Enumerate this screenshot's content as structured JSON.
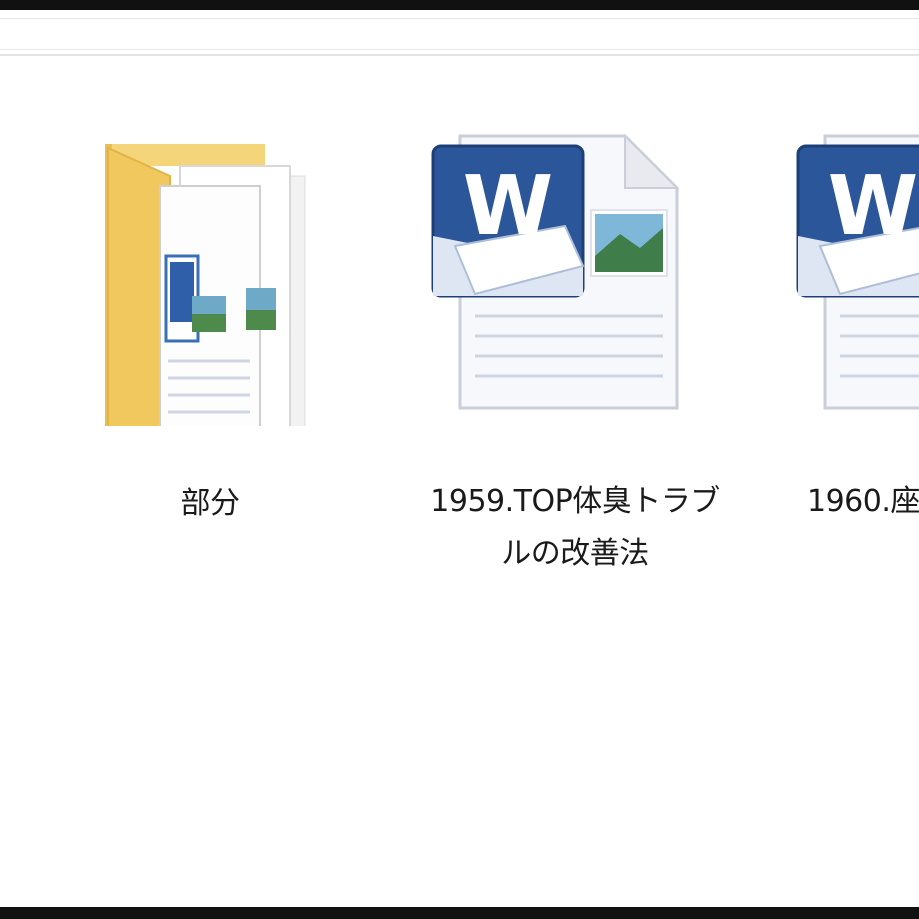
{
  "explorer": {
    "items": [
      {
        "name": "部分",
        "type": "folder",
        "icon": "folder-with-documents-icon"
      },
      {
        "name": "1959.TOP体臭トラブルの改善法",
        "type": "word-document",
        "icon": "word-document-icon"
      },
      {
        "name": "1960.座",
        "type": "word-document",
        "icon": "word-document-icon"
      }
    ]
  },
  "colors": {
    "folder_yellow": "#f3cf6b",
    "word_blue": "#2b579a",
    "frame_dark": "#111111"
  }
}
